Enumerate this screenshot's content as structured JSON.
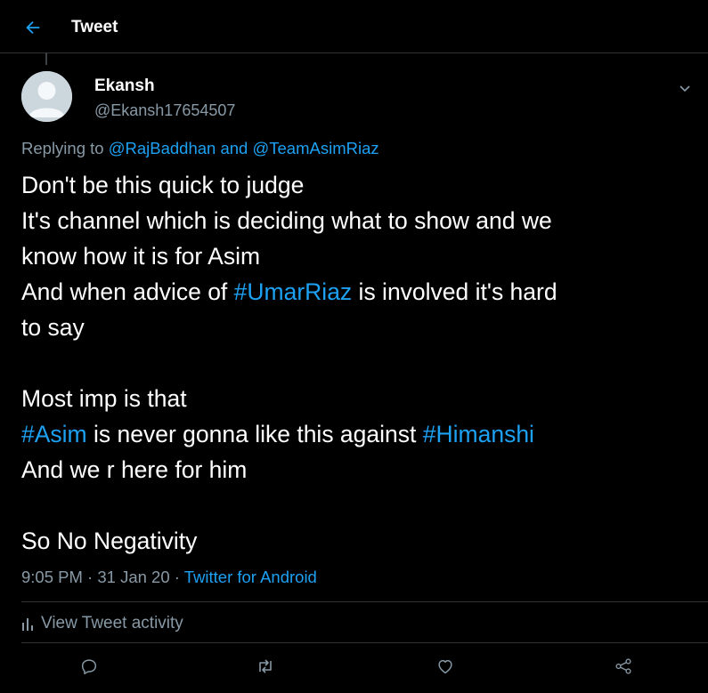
{
  "header": {
    "title": "Tweet"
  },
  "author": {
    "display_name": "Ekansh",
    "handle": "@Ekansh17654507"
  },
  "reply": {
    "prefix": "Replying to",
    "user1": "@RajBaddhan",
    "joiner": "and",
    "user2": "@TeamAsimRiaz"
  },
  "tweet": {
    "l1": "Don't be this quick to judge",
    "l2": "It's channel which is deciding what to show and we",
    "l3": "know how it is for Asim",
    "l4_pre": "And when advice of ",
    "l4_tag": "#UmarRiaz",
    "l4_post": " is involved it's hard",
    "l5": "to say",
    "l6": "Most imp is that",
    "l7_tag1": "#Asim",
    "l7_mid": " is never gonna like this against ",
    "l7_tag2": "#Himanshi",
    "l8": "And we r here for him",
    "l9": "So No Negativity"
  },
  "meta": {
    "time": "9:05 PM",
    "sep1": "·",
    "date": "31 Jan 20",
    "sep2": "·",
    "source": "Twitter for Android"
  },
  "activity": {
    "label": "View Tweet activity",
    "icon": "bar-chart-icon"
  },
  "actions": [
    "reply-icon",
    "retweet-icon",
    "like-icon",
    "share-icon"
  ],
  "colors": {
    "background": "#000000",
    "accent": "#1da1f2",
    "muted": "#8899a6",
    "divider": "#2f3336"
  }
}
